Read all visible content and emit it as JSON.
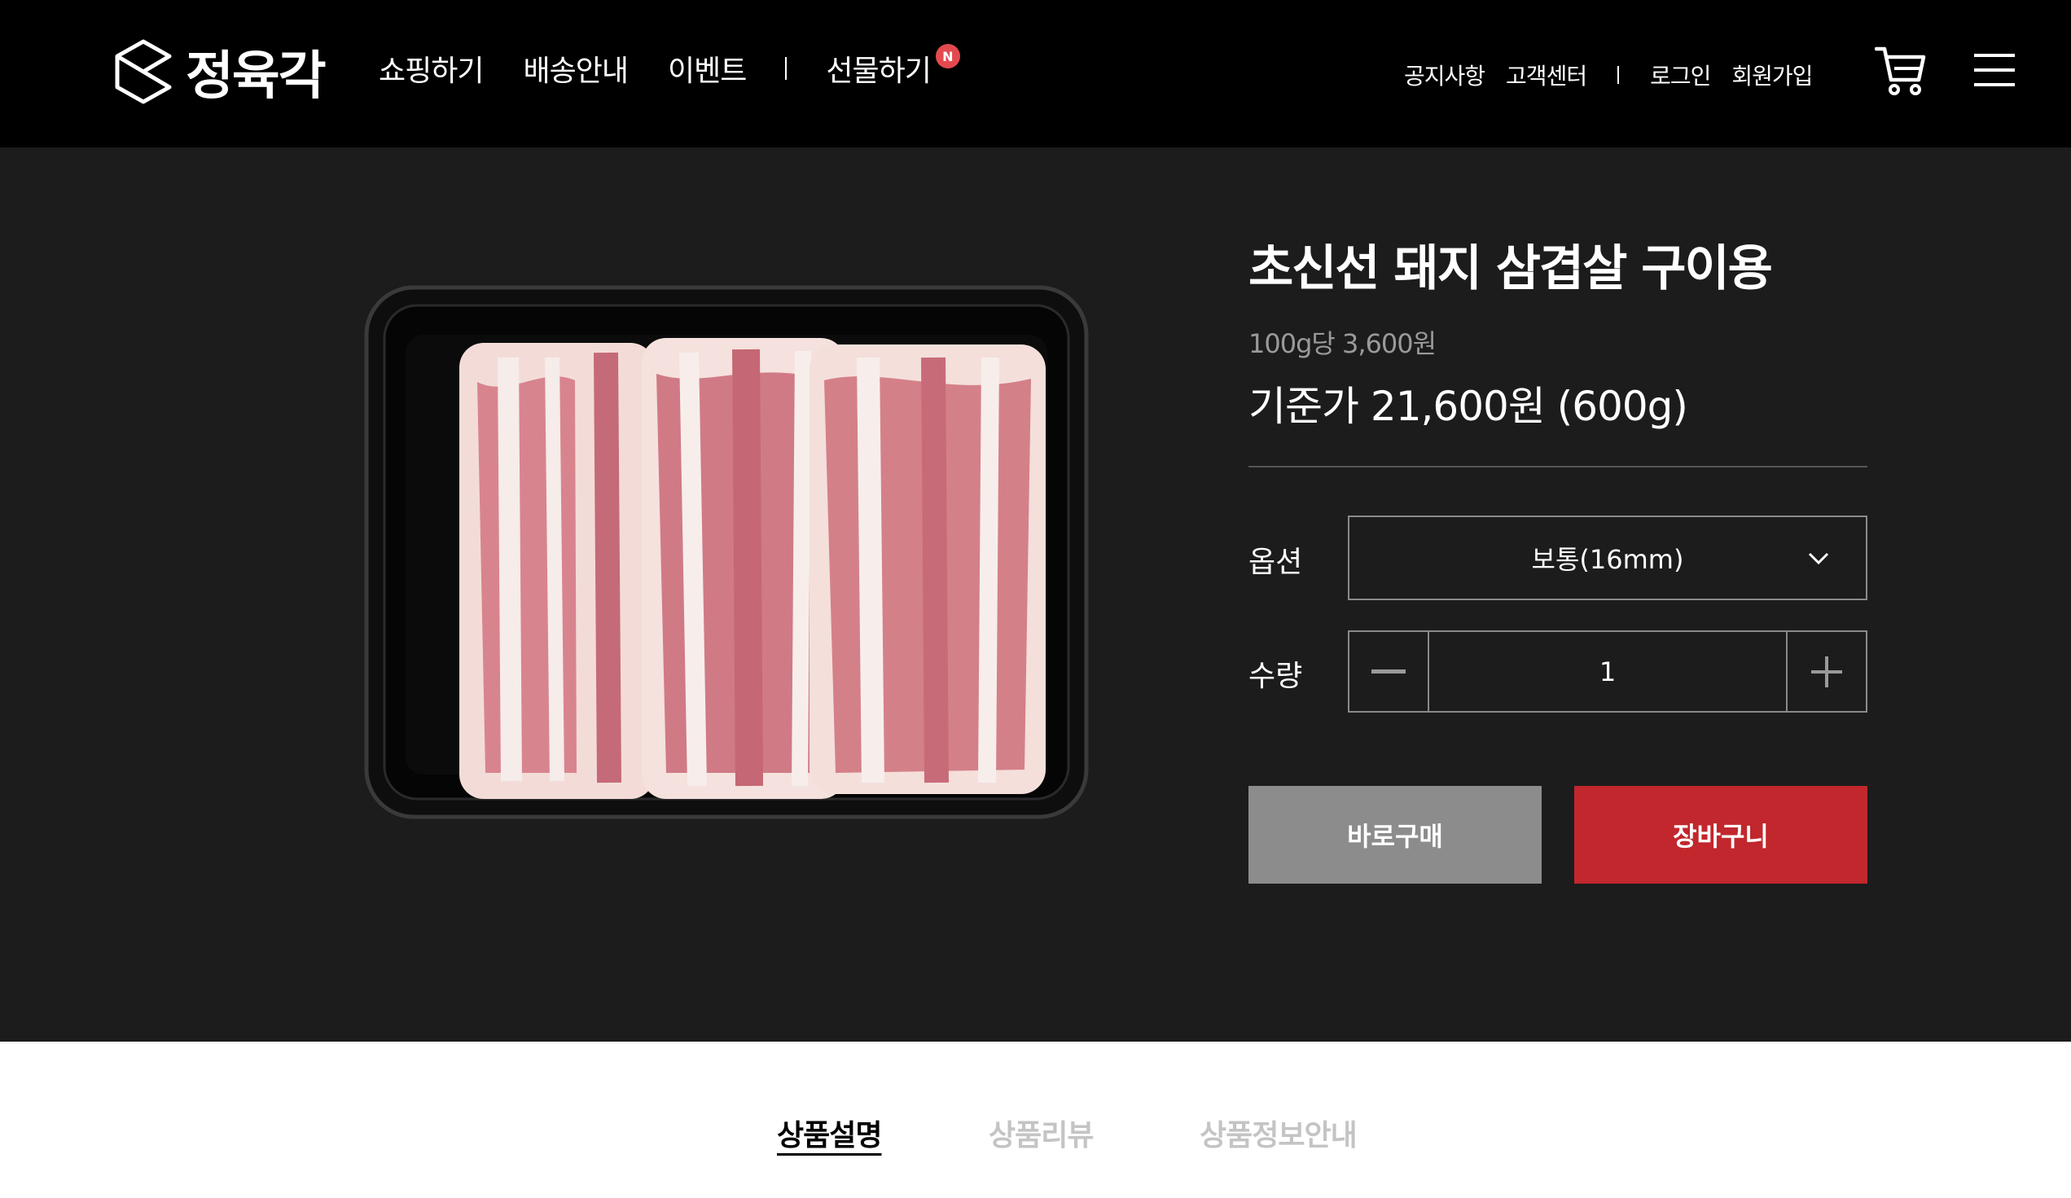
{
  "header": {
    "logo_text": "정육각",
    "nav": {
      "shopping": "쇼핑하기",
      "delivery": "배송안내",
      "event": "이벤트",
      "gift": "선물하기",
      "gift_badge": "N"
    },
    "util": {
      "notice": "공지사항",
      "support": "고객센터",
      "login": "로그인",
      "signup": "회원가입"
    },
    "icons": [
      "logo-mark-icon",
      "cart-icon",
      "hamburger-menu-icon"
    ]
  },
  "product": {
    "title": "초신선 돼지 삼겹살 구이용",
    "unit_price": "100g당 3,600원",
    "base_price": "기준가 21,600원 (600g)",
    "option_label": "옵션",
    "option_selected": "보통(16mm)",
    "quantity_label": "수량",
    "quantity": "1",
    "buy_now_label": "바로구매",
    "add_to_cart_label": "장바구니"
  },
  "tabs": [
    {
      "label": "상품설명",
      "active": true
    },
    {
      "label": "상품리뷰",
      "active": false
    },
    {
      "label": "상품정보안내",
      "active": false
    }
  ],
  "colors": {
    "header_bg": "#000000",
    "product_bg": "#1c1c1c",
    "buy_button": "#8c8c8c",
    "cart_button": "#c1272d",
    "badge": "#e34a4f"
  }
}
